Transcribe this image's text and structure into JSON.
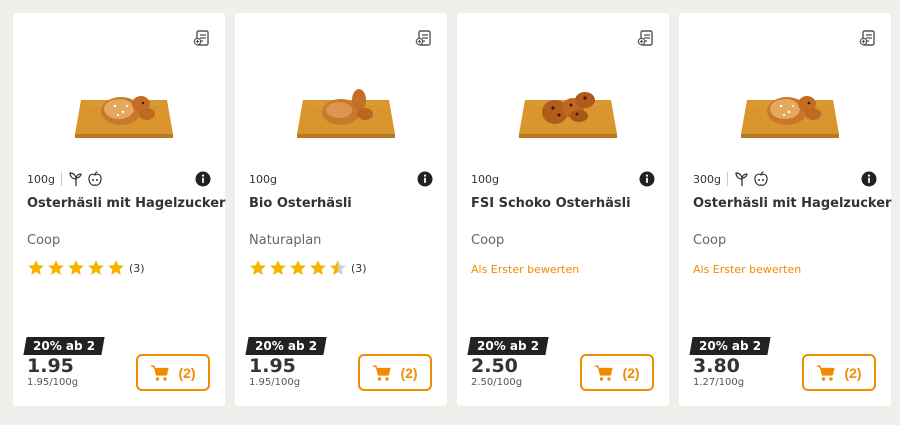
{
  "colors": {
    "accent": "#f08c00",
    "star": "#f5b400",
    "promo_bg": "#222222",
    "background": "#f0efec"
  },
  "products": [
    {
      "image_icon": "bread-bunny-with-sugar-icon",
      "weight": "100g",
      "badges": [
        "plant-icon",
        "apple-icon"
      ],
      "name": "Osterhäsli mit Hagelzucker",
      "brand": "Coop",
      "rating": 5,
      "rating_count": "(3)",
      "rating_text": "",
      "promo": "20% ab 2",
      "price": "1.95",
      "unit_price": "1.95/100g",
      "cart_label": "(2)"
    },
    {
      "image_icon": "bread-bunny-icon",
      "weight": "100g",
      "badges": [],
      "name": "Bio Osterhäsli",
      "brand": "Naturaplan",
      "rating": 4.5,
      "rating_count": "(3)",
      "rating_text": "",
      "promo": "20% ab 2",
      "price": "1.95",
      "unit_price": "1.95/100g",
      "cart_label": "(2)"
    },
    {
      "image_icon": "chocolate-bread-bunny-icon",
      "weight": "100g",
      "badges": [],
      "name": "FSI Schoko Osterhäsli",
      "brand": "Coop",
      "rating": 0,
      "rating_count": "",
      "rating_text": "Als Erster bewerten",
      "promo": "20% ab 2",
      "price": "2.50",
      "unit_price": "2.50/100g",
      "cart_label": "(2)"
    },
    {
      "image_icon": "bread-bunny-with-sugar-icon",
      "weight": "300g",
      "badges": [
        "plant-icon",
        "apple-icon"
      ],
      "name": "Osterhäsli mit Hagelzucker",
      "brand": "Coop",
      "rating": 0,
      "rating_count": "",
      "rating_text": "Als Erster bewerten",
      "promo": "20% ab 2",
      "price": "3.80",
      "unit_price": "1.27/100g",
      "cart_label": "(2)"
    }
  ]
}
